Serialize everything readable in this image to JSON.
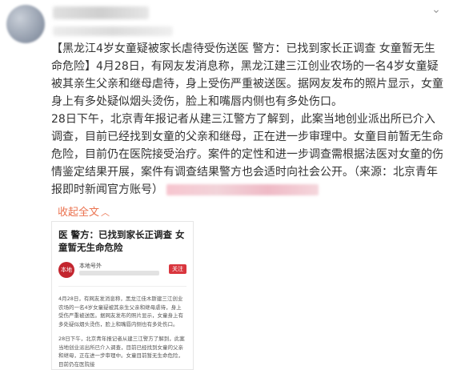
{
  "post": {
    "paragraph1": "【黑龙江4岁女童疑被家长虐待受伤送医 警方：已找到家长正调查 女童暂无生命危险】4月28日，有网友发消息称，黑龙江建三江创业农场的一名4岁女童疑被其亲生父亲和继母虐待，身上受伤严重被送医。据网友发布的照片显示，女童身上有多处疑似烟头烫伤，脸上和嘴唇内侧也有多处伤口。",
    "paragraph2": "28日下午，北京青年报记者从建三江警方了解到，此案当地创业派出所已介入调查，目前已经找到女童的父亲和继母，正在进一步审理中。女童目前暂无生命危险，目前仍在医院接受治疗。案件的定性和进一步调查需根据法医对女童的伤情鉴定结果开展，案件有调查结果警方也会适时向社会公开。（来源：北京青年报即时新闻官方账号）",
    "collapse_label": "收起全文",
    "collapse_arrow": "︿"
  },
  "article": {
    "title": "医 警方：已找到家长正调查 女童暂无生命危险",
    "source_logo": "本地",
    "source_name": "本地号外",
    "follow_label": "关注",
    "body1": "4月28日，有网友发消息称，黑龙江佳木斯建三江创业农场的一名4岁女童疑被其亲生父亲和继母虐待，身上受伤严重被送医。据网友发布的照片显示，女童身上有多处疑似烟头烫伤，脸上和嘴唇内侧也有多处伤口。",
    "body2": "28日下午，北京青年报记者从建三江警方了解到，此案当地创业派出所已介入调查，目前已经找到女童的父亲和继母，正在进一步审理中。女童目前暂无生命危险，目前仍在医院接"
  },
  "icons": {
    "menu": "chevron-down-icon",
    "avatar": "avatar"
  },
  "colors": {
    "link": "#eb7350",
    "follow_button": "#d9363e",
    "blur_pink": "#f2c6cf"
  }
}
